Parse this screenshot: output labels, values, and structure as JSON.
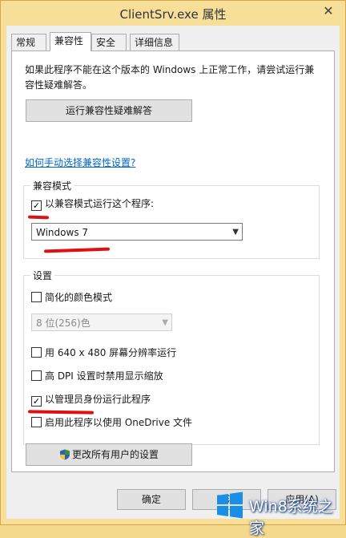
{
  "window": {
    "title": "ClientSrv.exe 属性",
    "close_glyph": "✕"
  },
  "tabs": [
    {
      "label": "常规"
    },
    {
      "label": "兼容性"
    },
    {
      "label": "安全"
    },
    {
      "label": "详细信息"
    }
  ],
  "compat": {
    "description": "如果此程序不能在这个版本的 Windows 上正常工作，请尝试运行兼容性疑难解答。",
    "troubleshoot_button": "运行兼容性疑难解答",
    "manual_link": "如何手动选择兼容性设置?",
    "mode_group": {
      "title": "兼容模式",
      "checkbox_label": "以兼容模式运行这个程序:",
      "checked": true,
      "selected_os": "Windows 7"
    },
    "settings_group": {
      "title": "设置",
      "reduced_color": {
        "label": "简化的颜色模式",
        "checked": false
      },
      "color_depth": "8 位(256)色",
      "resolution": {
        "label": "用 640 x 480 屏幕分辨率运行",
        "checked": false
      },
      "dpi": {
        "label": "高 DPI 设置时禁用显示缩放",
        "checked": false
      },
      "admin": {
        "label": "以管理员身份运行此程序",
        "checked": true
      },
      "onedrive": {
        "label": "启用此程序以使用 OneDrive 文件",
        "checked": false
      }
    },
    "all_users_button": "更改所有用户的设置"
  },
  "footer": {
    "ok": "确定",
    "cancel": "取消",
    "apply": "应用(A)"
  },
  "check_glyph": "✓",
  "watermark": {
    "text": "Win8系统之家"
  },
  "colors": {
    "annotation_red": "#e01010",
    "link_blue": "#0066cc",
    "window_frame": "#f7df9a"
  }
}
